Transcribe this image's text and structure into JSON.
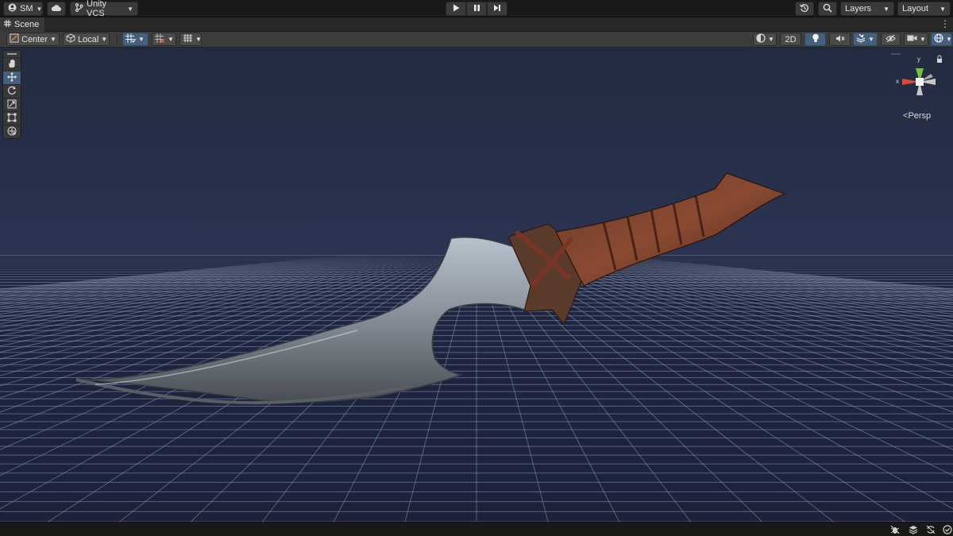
{
  "toolbar": {
    "account_label": "SM",
    "cloud_icon": "cloud-icon",
    "vcs_label": "Unity VCS",
    "play_icon": "play-icon",
    "pause_icon": "pause-icon",
    "step_icon": "step-icon",
    "history_icon": "undo-history-icon",
    "search_icon": "search-icon",
    "layers_label": "Layers",
    "layout_label": "Layout"
  },
  "tab": {
    "scene_label": "Scene"
  },
  "scene_toolbar": {
    "pivot_label": "Center",
    "space_label": "Local",
    "mode_2d_label": "2D"
  },
  "viewport": {
    "projection_label": "Persp",
    "gizmo_x_label": "x",
    "gizmo_y_label": "y"
  },
  "colors": {
    "active_blue": "#46607c",
    "gizmo_x": "#e0483a",
    "gizmo_y": "#77c43c",
    "sky_top": "#232b40",
    "floor": "#1c223a"
  }
}
